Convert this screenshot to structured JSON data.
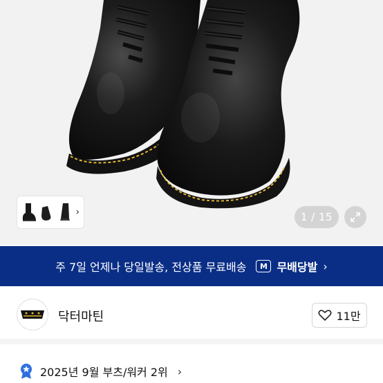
{
  "gallery": {
    "counter": "1 / 15",
    "thumbnail_count": 3
  },
  "banner": {
    "text": "주 7일 언제나 당일발송, 전상품 무료배송",
    "badge": "M",
    "brand": "무배당발",
    "background": "#0a2e86"
  },
  "brand": {
    "name": "닥터마틴",
    "logo_text": "Dr. Martens",
    "likes": "11만"
  },
  "ranking": {
    "text": "2025년 9월 부츠/워커 2위",
    "icon": "ribbon-star-icon",
    "accent": "#2f6fe0"
  }
}
